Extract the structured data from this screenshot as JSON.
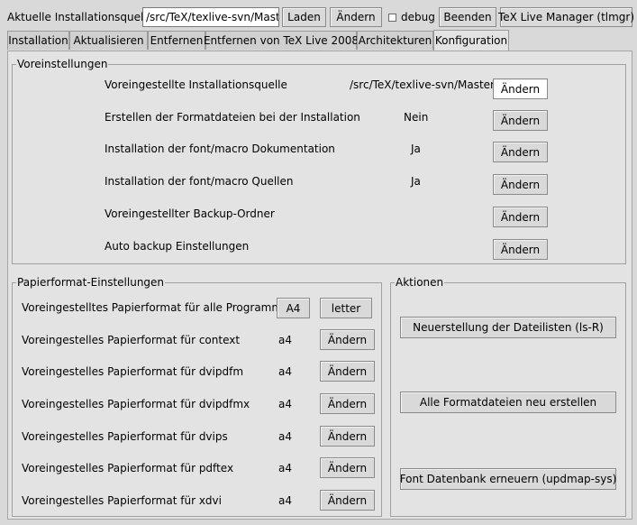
{
  "toolbar": {
    "source_label": "Aktuelle Installationsquelle",
    "source_value": "/src/TeX/texlive-svn/Master",
    "load_button": "Laden",
    "change_button": "Ändern",
    "debug_label": "debug",
    "quit_button": "Beenden",
    "tlmgr_button": "TeX Live Manager (tlmgr)"
  },
  "tabs": [
    {
      "label": "Installation"
    },
    {
      "label": "Aktualisieren"
    },
    {
      "label": "Entfernen"
    },
    {
      "label": "Entfernen von TeX Live 2008"
    },
    {
      "label": "Architekturen"
    },
    {
      "label": "Konfiguration"
    }
  ],
  "defaults": {
    "title": "Voreinstellungen",
    "rows": [
      {
        "label": "Voreingestellte Installationsquelle",
        "value": "/src/TeX/texlive-svn/Master",
        "button": "Ändern"
      },
      {
        "label": "Erstellen der Formatdateien bei der Installation",
        "value": "Nein",
        "button": "Ändern"
      },
      {
        "label": "Installation der font/macro Dokumentation",
        "value": "Ja",
        "button": "Ändern"
      },
      {
        "label": "Installation der font/macro Quellen",
        "value": "Ja",
        "button": "Ändern"
      },
      {
        "label": "Voreingestellter Backup-Ordner",
        "value": "",
        "button": "Ändern"
      },
      {
        "label": "Auto backup Einstellungen",
        "value": "",
        "button": "Ändern"
      }
    ]
  },
  "paper": {
    "title": "Papierformat-Einstellungen",
    "all_label": "Voreingestelltes Papierformat für alle Programme",
    "a4_button": "A4",
    "letter_button": "letter",
    "rows": [
      {
        "label": "Voreingestelles Papierformat für context",
        "value": "a4",
        "button": "Ändern"
      },
      {
        "label": "Voreingestelles Papierformat für dvipdfm",
        "value": "a4",
        "button": "Ändern"
      },
      {
        "label": "Voreingestelles Papierformat für dvipdfmx",
        "value": "a4",
        "button": "Ändern"
      },
      {
        "label": "Voreingestelles Papierformat für dvips",
        "value": "a4",
        "button": "Ändern"
      },
      {
        "label": "Voreingestelles Papierformat für pdftex",
        "value": "a4",
        "button": "Ändern"
      },
      {
        "label": "Voreingestelles Papierformat für xdvi",
        "value": "a4",
        "button": "Ändern"
      }
    ]
  },
  "actions": {
    "title": "Aktionen",
    "buttons": [
      {
        "label": "Neuerstellung der Dateilisten (ls-R)"
      },
      {
        "label": "Alle Formatdateien neu erstellen"
      },
      {
        "label": "Font Datenbank erneuern (updmap-sys)"
      }
    ]
  }
}
